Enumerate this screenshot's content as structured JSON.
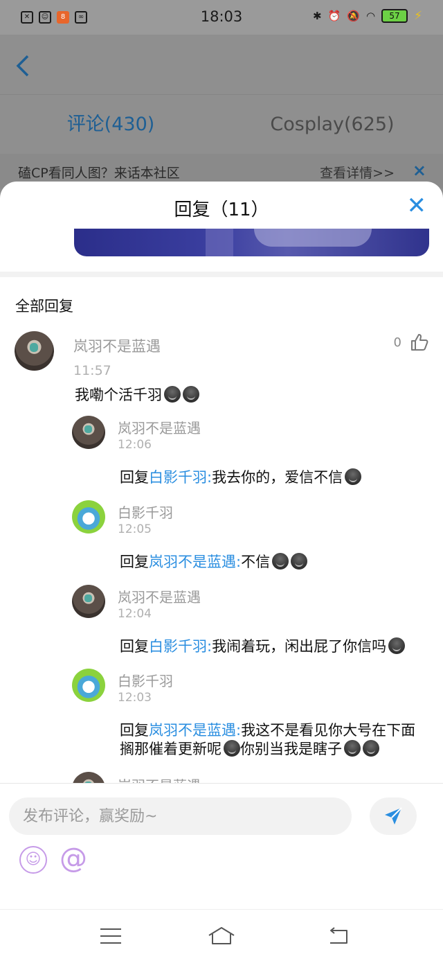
{
  "status_bar": {
    "time": "18:03",
    "battery": "57"
  },
  "nav": {
    "back_label": "<"
  },
  "tabs": [
    {
      "label": "评论(430)",
      "active": true
    },
    {
      "label": "Cosplay(625)",
      "active": false
    }
  ],
  "banner": {
    "text": "磕CP看同人图？来话本社区",
    "more": "查看详情>>",
    "close": "×"
  },
  "sheet": {
    "title": "回复（11）",
    "close": "✕",
    "section_title": "全部回复",
    "main_comment": {
      "name": "岚羽不是蓝遇",
      "time": "11:57",
      "text": "我嘞个活千羽",
      "likes": "0"
    },
    "reply_prefix": "回复",
    "replies": [
      {
        "name": "岚羽不是蓝遇",
        "time": "12:06",
        "mention": "白影千羽:",
        "text": "我去你的，爱信不信",
        "avatar": "dark"
      },
      {
        "name": "白影千羽",
        "time": "12:05",
        "mention": "岚羽不是蓝遇:",
        "text": "不信",
        "avatar": "green"
      },
      {
        "name": "岚羽不是蓝遇",
        "time": "12:04",
        "mention": "白影千羽:",
        "text": "我闹着玩，闲出屁了你信吗",
        "avatar": "dark"
      },
      {
        "name": "白影千羽",
        "time": "12:03",
        "mention": "岚羽不是蓝遇:",
        "text": "我这不是看见你大号在下面搁那催着更新呢",
        "text2": "你别当我是瞎子",
        "avatar": "green"
      },
      {
        "name": "岚羽不是蓝遇"
      }
    ]
  },
  "composer": {
    "placeholder": "发布评论，赢奖励~"
  }
}
